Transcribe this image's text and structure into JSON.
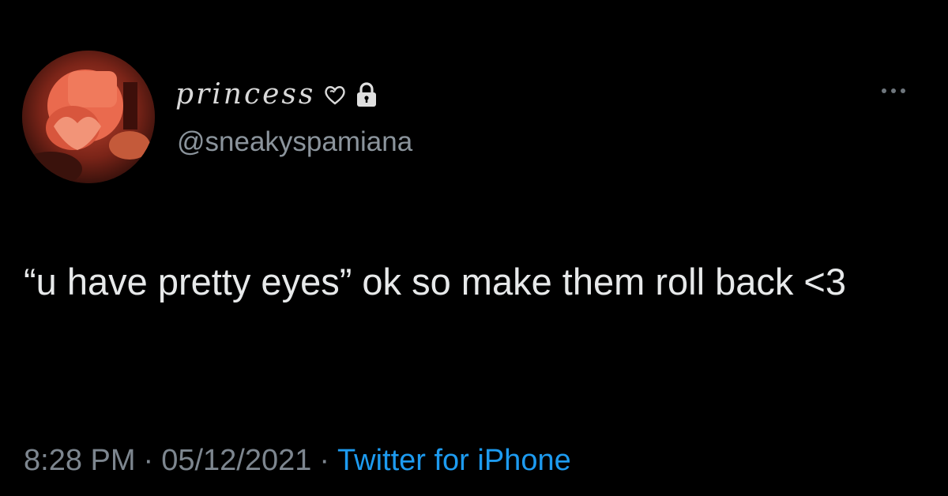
{
  "tweet": {
    "display_name": "princess",
    "handle": "@sneakyspamiana",
    "text": "“u have pretty eyes” ok so make them roll back <3",
    "time": "8:28 PM",
    "separator": "·",
    "date": "05/12/2021",
    "source": "Twitter for iPhone"
  },
  "icons": {
    "avatar": "profile-avatar",
    "badge_1": "heart-icon",
    "badge_2": "lock-icon",
    "more": "more-options-icon"
  },
  "colors": {
    "background": "#000000",
    "text_primary": "#e7e9ea",
    "text_secondary": "#8b949c",
    "link": "#1d9bf0",
    "avatar_accent": "#e0523a"
  }
}
